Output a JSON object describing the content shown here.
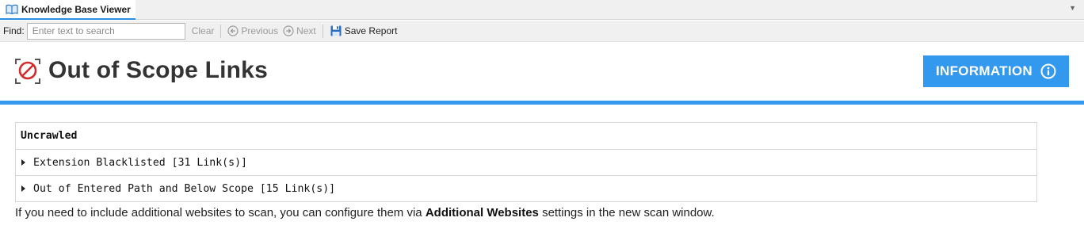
{
  "window": {
    "tab_title": "Knowledge Base Viewer"
  },
  "toolbar": {
    "find_label": "Find:",
    "search_placeholder": "Enter text to search",
    "search_value": "",
    "clear_label": "Clear",
    "previous_label": "Previous",
    "next_label": "Next",
    "save_label": "Save Report"
  },
  "header": {
    "title": "Out of Scope Links",
    "title_icon": "blocked-link-icon",
    "info_button_label": "INFORMATION",
    "accent_color": "#3399ee"
  },
  "table": {
    "heading": "Uncrawled",
    "rows": [
      {
        "label": "Extension Blacklisted [31 Link(s)]",
        "expanded": false
      },
      {
        "label": "Out of Entered Path and Below Scope [15 Link(s)]",
        "expanded": false
      }
    ]
  },
  "footer": {
    "note_before": "If you need to include additional websites to scan, you can configure them via ",
    "note_bold": "Additional Websites",
    "note_after": " settings in the new scan window."
  }
}
